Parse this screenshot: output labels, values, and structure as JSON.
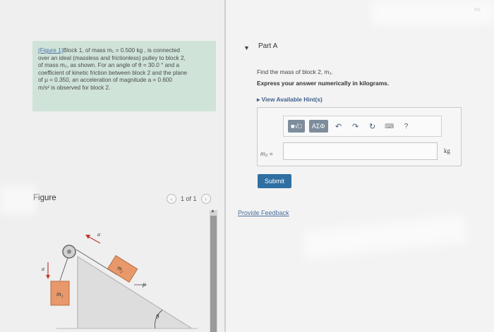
{
  "problem": {
    "fig_link": "(Figure 1)",
    "line1": "Block 1, of mass m₁ = 0.500 kg , is connected",
    "line2": "over an ideal (massless and frictionless) pulley to block 2,",
    "line3": "of mass m₂, as shown. For an angle of θ = 30.0 ° and a",
    "line4": "coefficient of kinetic friction between block 2 and the plane",
    "line5": "of μ = 0.350, an acceleration of magnitude a = 0.600",
    "line6": "m/s² is observed for block 2."
  },
  "figure": {
    "label": "Figure",
    "pager_text": "1 of 1",
    "prev_icon": "chevron-left-icon",
    "next_icon": "chevron-right-icon",
    "labels": {
      "a_top": "a",
      "a_left": "a",
      "m1": "m₁",
      "m2": "m₂",
      "mu": "μ",
      "theta": "θ"
    }
  },
  "part": {
    "caret_icon": "caret-down-icon",
    "title": "Part A",
    "question": "Find the mass of block 2, m₂.",
    "instruction": "Express your answer numerically in kilograms.",
    "hints": "▸  View Available Hint(s)"
  },
  "toolbar": {
    "btn_templates": "■√□",
    "btn_symbols": "ΑΣΦ",
    "undo_icon": "undo-icon",
    "redo_icon": "redo-icon",
    "reset_icon": "reset-icon",
    "keyboard_icon": "keyboard-icon",
    "help_label": "?"
  },
  "answer": {
    "var_label": "m₂ =",
    "value": "",
    "unit": "kg",
    "submit_label": "Submit"
  },
  "feedback": "Provide Feedback",
  "corner_tag": "Re"
}
